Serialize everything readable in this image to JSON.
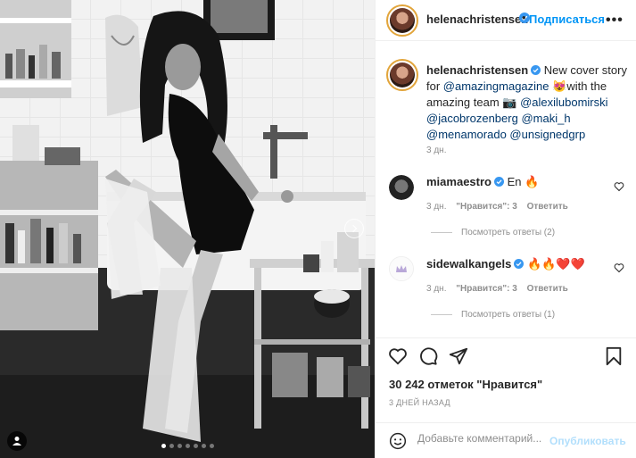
{
  "post": {
    "author": "helenachristensen",
    "follow_label": "Подписаться",
    "header_dot": "•",
    "more_label": "•••",
    "caption_intro": " New cover story for ",
    "mention_1": "@amazingmagazine",
    "caption_mid_emoji": "😻",
    "caption_mid": "with the amazing team ",
    "camera_emoji": "📷",
    "mention_2": "@alexilubomirski",
    "mention_3": "@jacobrozenberg",
    "mention_4": "@maki_h",
    "mention_5": "@menamorado",
    "mention_6": "@unsignedgrp",
    "caption_time": "3 дн."
  },
  "comments": [
    {
      "user": "miamaestro",
      "text": "En 🔥",
      "time": "3 дн.",
      "likes": "\"Нравится\": 3",
      "reply": "Ответить",
      "replies_label": "Посмотреть ответы (2)"
    },
    {
      "user": "sidewalkangels",
      "text": "🔥🔥❤️❤️",
      "time": "3 дн.",
      "likes": "\"Нравится\": 3",
      "reply": "Ответить",
      "replies_label": "Посмотреть ответы (1)"
    }
  ],
  "stats": {
    "likes": "30 242 отметок \"Нравится\"",
    "date": "3 ДНЕЙ НАЗАД"
  },
  "composer": {
    "placeholder": "Добавьте комментарий...",
    "publish": "Опубликовать"
  },
  "carousel": {
    "slides": 7,
    "active_slide": 1
  },
  "colors": {
    "accent": "#0095f6",
    "verified": "#3897f0",
    "ring": "#e2a53b"
  },
  "icons": [
    "like-icon",
    "comment-icon",
    "share-icon",
    "save-icon",
    "emoji-icon",
    "more-icon",
    "next-icon",
    "tag-user-icon",
    "verified-badge-icon"
  ]
}
